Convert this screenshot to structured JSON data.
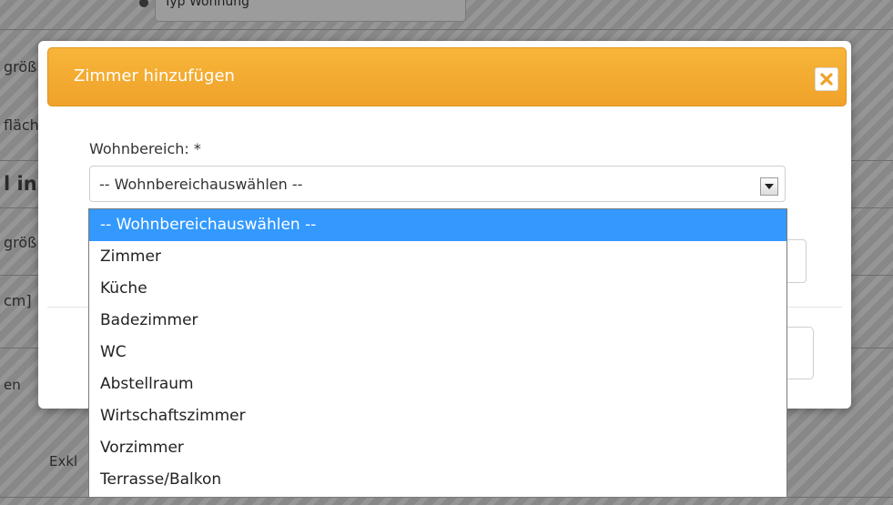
{
  "background": {
    "left_fragments": [
      "größ",
      "fläch",
      "l in",
      "größ",
      "cm]",
      "en",
      "Exkl"
    ],
    "top_text": "Typ Wohnung"
  },
  "modal": {
    "title": "Zimmer hinzufügen",
    "close_icon": "close-icon",
    "header_color": "#f5ac33",
    "field_label": "Wohnbereich: *",
    "select": {
      "value": "-- Wohnbereichauswählen --",
      "arrow_icon": "chevron-down-icon"
    }
  },
  "dropdown": {
    "selected_color": "#3399ff",
    "options": [
      {
        "label": "-- Wohnbereichauswählen --",
        "selected": true
      },
      {
        "label": "Zimmer",
        "selected": false
      },
      {
        "label": "Küche",
        "selected": false
      },
      {
        "label": "Badezimmer",
        "selected": false
      },
      {
        "label": "WC",
        "selected": false
      },
      {
        "label": "Abstellraum",
        "selected": false
      },
      {
        "label": "Wirtschaftszimmer",
        "selected": false
      },
      {
        "label": "Vorzimmer",
        "selected": false
      },
      {
        "label": "Terrasse/Balkon",
        "selected": false
      }
    ]
  }
}
